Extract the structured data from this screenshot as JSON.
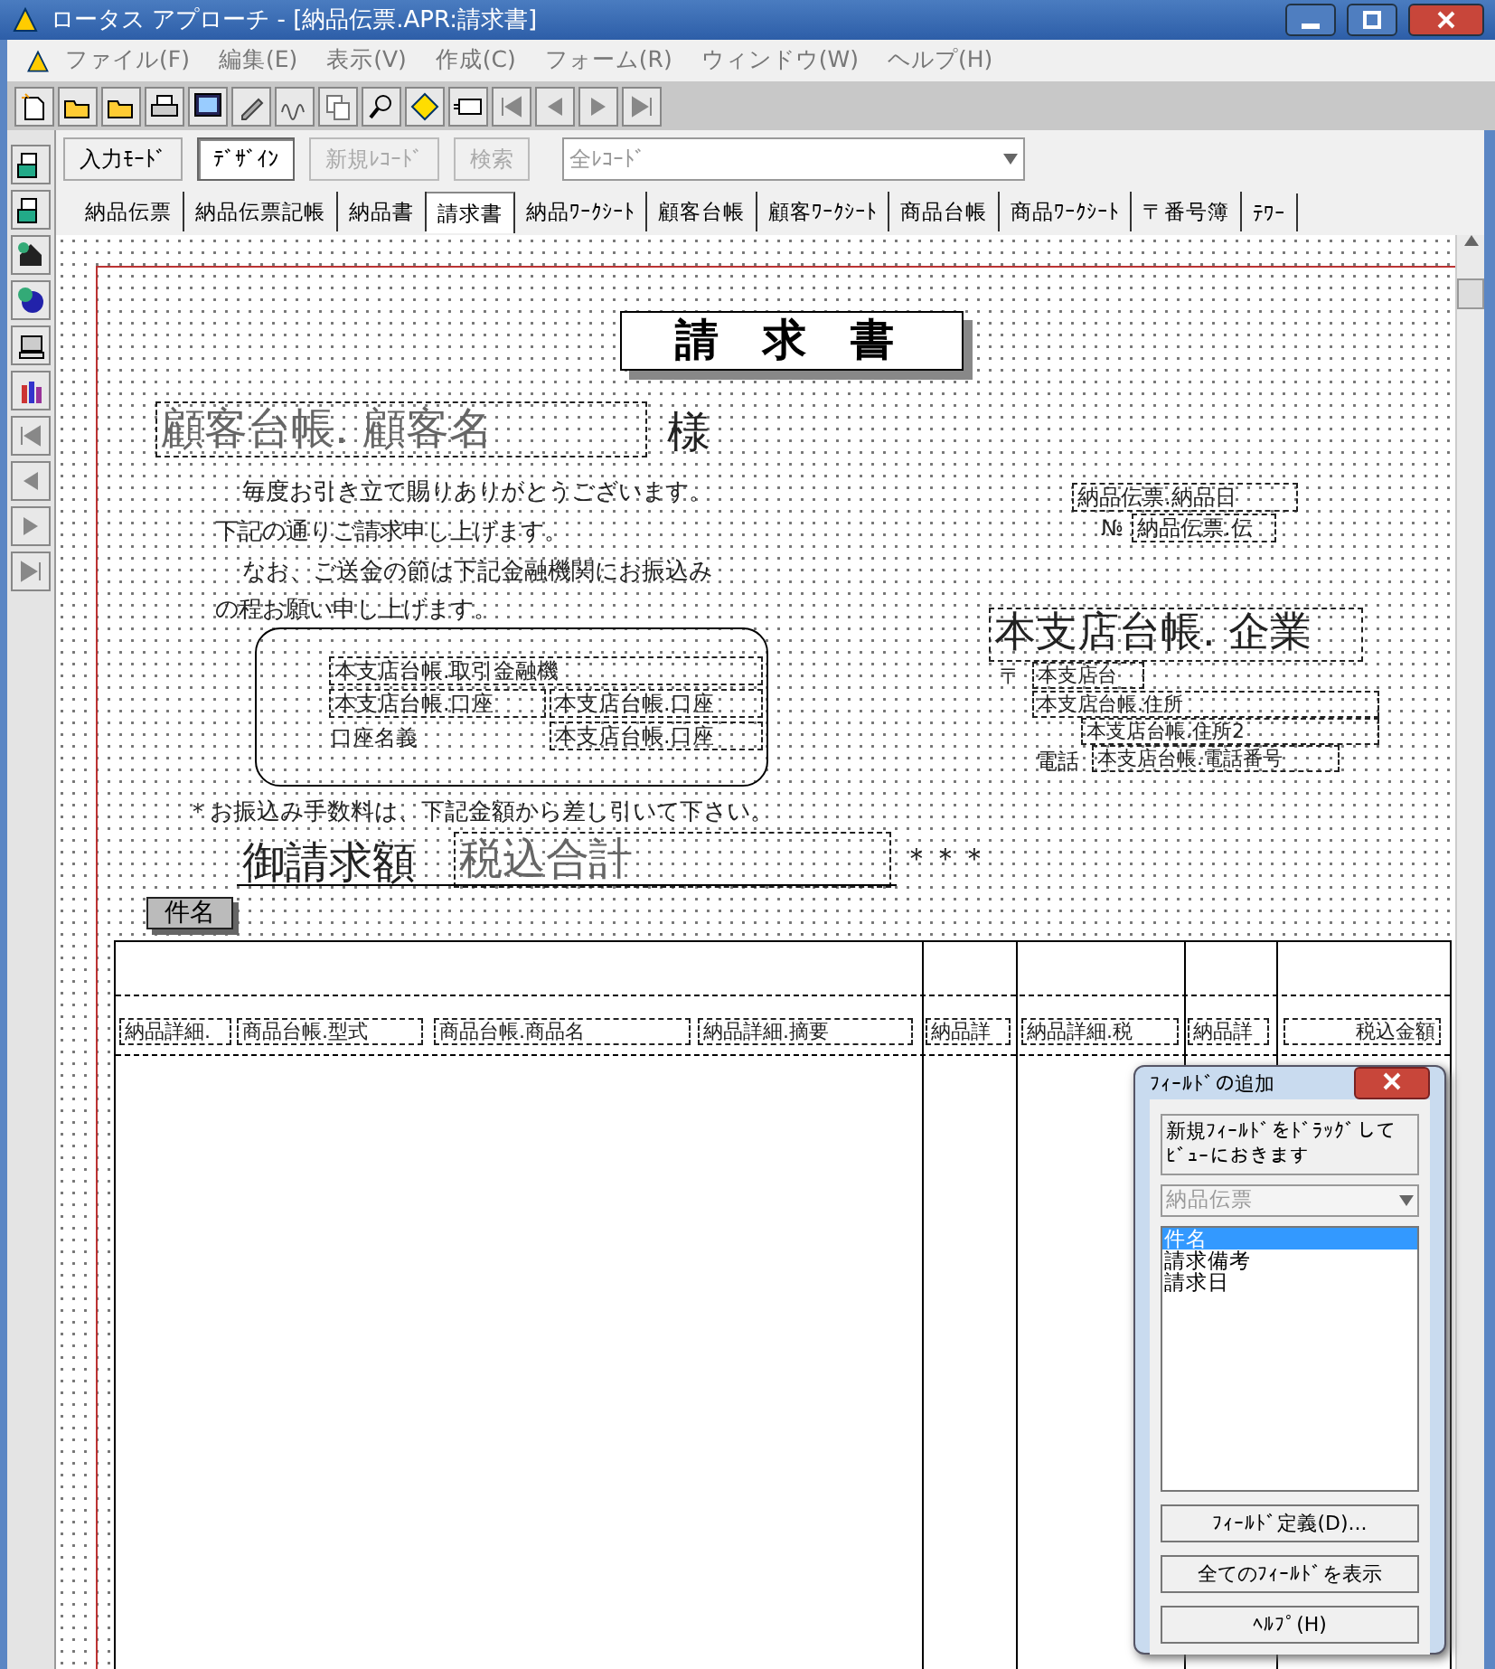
{
  "window": {
    "title": "ロータス アプローチ - [納品伝票.APR:請求書]"
  },
  "menu": [
    "ファイル(F)",
    "編集(E)",
    "表示(V)",
    "作成(C)",
    "フォーム(R)",
    "ウィンドウ(W)",
    "ヘルプ(H)"
  ],
  "modes": [
    {
      "label": "入力ﾓｰﾄﾞ",
      "selected": false
    },
    {
      "label": "ﾃﾞｻﾞｲﾝ",
      "selected": true
    }
  ],
  "actions": [
    {
      "label": "新規ﾚｺｰﾄﾞ",
      "disabled": true
    },
    {
      "label": "検索",
      "disabled": true
    }
  ],
  "record_filter": "全ﾚｺｰﾄﾞ",
  "tabs": [
    {
      "label": "納品伝票",
      "selected": false
    },
    {
      "label": "納品伝票記帳",
      "selected": false
    },
    {
      "label": "納品書",
      "selected": false
    },
    {
      "label": "請求書",
      "selected": true
    },
    {
      "label": "納品ﾜｰｸｼｰﾄ",
      "selected": false
    },
    {
      "label": "顧客台帳",
      "selected": false
    },
    {
      "label": "顧客ﾜｰｸｼｰﾄ",
      "selected": false
    },
    {
      "label": "商品台帳",
      "selected": false
    },
    {
      "label": "商品ﾜｰｸｼｰﾄ",
      "selected": false
    },
    {
      "label": "〒番号簿",
      "selected": false
    },
    {
      "label": "ﾃﾜｰ",
      "selected": false
    }
  ],
  "form": {
    "title": "請 求 書",
    "customer_field": "顧客台帳. 顧客名",
    "honorific": "様",
    "greeting": [
      "毎度お引き立て賜りありがとうございます。",
      "下記の通りご請求申し上げます。",
      "なお、ご送金の節は下記金融機関にお振込み",
      "の程お願い申し上げます。"
    ],
    "bank_box": {
      "bank_field": "本支店台帳.取引金融機",
      "account_field": "本支店台帳.口座",
      "account_number_field": "本支店台帳.口座",
      "holder_label": "口座名義",
      "holder_field": "本支店台帳.口座"
    },
    "fee_note": "＊お振込み手数料は、下記金額から差し引いて下さい。",
    "amount_label": "御請求額",
    "amount_field": "税込合計",
    "amount_suffix": "＊＊＊",
    "subject_label": "件名",
    "date_field": "納品伝票.納品日",
    "number_label": "№",
    "number_field": "納品伝票.伝",
    "company_field": "本支店台帳. 企業",
    "postal_label": "〒",
    "postal_field": "本支店台",
    "address_field": "本支店台帳.住所",
    "address2_field": "本支店台帳.住所2",
    "phone_label": "電話",
    "phone_field": "本支店台帳.電話番号",
    "detail_fields": [
      "納品詳細.",
      "商品台帳.型式",
      "商品台帳.商品名",
      "納品詳細.摘要",
      "納品詳",
      "納品詳細.税",
      "納品詳",
      "税込金額"
    ]
  },
  "dialog": {
    "title": "ﾌｨｰﾙﾄﾞの追加",
    "instruction": "新規ﾌｨｰﾙﾄﾞをﾄﾞﾗｯｸﾞしてﾋﾞｭｰにおきます",
    "database": "納品伝票",
    "fields": [
      {
        "label": "件名",
        "selected": true
      },
      {
        "label": "請求備考",
        "selected": false
      },
      {
        "label": "請求日",
        "selected": false
      }
    ],
    "buttons": [
      "ﾌｨｰﾙﾄﾞ定義(D)...",
      "全てのﾌｨｰﾙﾄﾞを表示",
      "ﾍﾙﾌﾟ(H)"
    ]
  }
}
